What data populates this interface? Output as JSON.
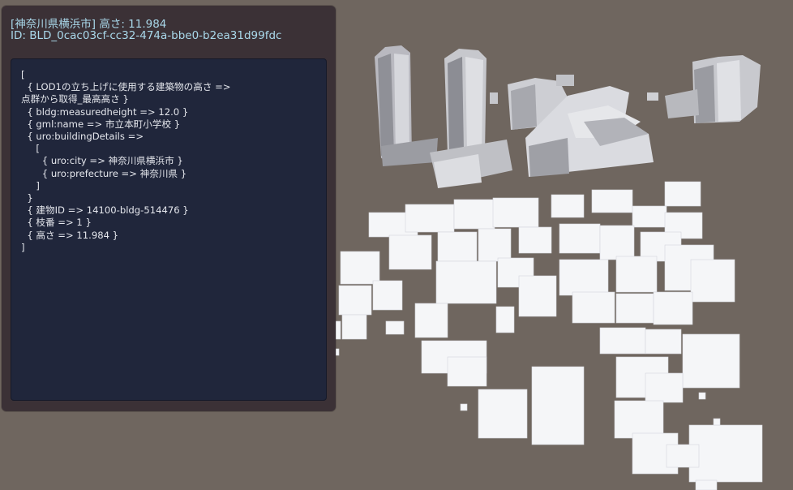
{
  "header": {
    "title": "[神奈川県横浜市]   高さ: 11.984",
    "id_line": "ID: BLD_0cac03cf-cc32-474a-bbe0-b2ea31d99fdc"
  },
  "attributes": {
    "lines": [
      "[",
      "  { LOD1の立ち上げに使用する建築物の高さ =>",
      "点群から取得_最高高さ }",
      "  { bldg:measuredheight => 12.0 }",
      "  { gml:name => 市立本町小学校 }",
      "  { uro:buildingDetails =>",
      "     [",
      "       { uro:city => 神奈川県横浜市 }",
      "       { uro:prefecture => 神奈川県 }",
      "     ]",
      "  }",
      "  { 建物ID => 14100-bldg-514476 }",
      "  { 枝番 => 1 }",
      "  { 高さ => 11.984 }",
      "]"
    ]
  },
  "colors": {
    "background": "#6f665f",
    "panel": "#3b3136",
    "inner_panel": "#20263b",
    "header_text": "#a9d8ea",
    "body_text": "#e4e6ec"
  }
}
